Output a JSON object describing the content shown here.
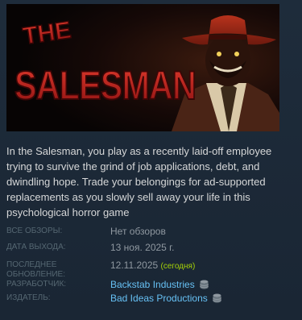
{
  "capsule": {
    "title_top": "THE",
    "title_main": "SALESMAN"
  },
  "description": "In the Salesman, you play as a recently laid-off employee trying to survive the grind of job applications, debt, and dwindling hope. Trade your belongings for ad-supported replacements as you slowly sell away your life in this psychological horror game",
  "meta": {
    "reviews_label": "ВСЕ ОБЗОРЫ:",
    "reviews_value": "Нет обзоров",
    "release_label": "ДАТА ВЫХОДА:",
    "release_value": "13 ноя. 2025 г.",
    "updated_label_1": "ПОСЛЕДНЕЕ",
    "updated_label_2": "ОБНОВЛЕНИЕ:",
    "updated_value": "12.11.2025",
    "updated_today": "(сегодня)",
    "developer_label": "РАЗРАБОТЧИК:",
    "developer_value": "Backstab Industries",
    "publisher_label": "ИЗДАТЕЛЬ:",
    "publisher_value": "Bad Ideas Productions"
  },
  "colors": {
    "background": "#1b2838",
    "text": "#d6d7d8",
    "label": "#556772",
    "value": "#8f98a0",
    "link": "#66c0f4",
    "today": "#a4d007",
    "title_red": "#c41d1d"
  },
  "icons": {
    "developer_icon": "stack-icon",
    "publisher_icon": "stack-icon"
  }
}
